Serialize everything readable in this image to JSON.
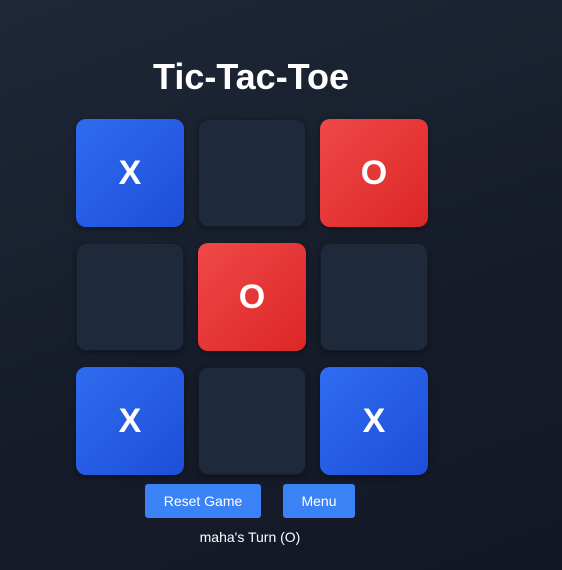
{
  "game": {
    "title": "Tic-Tac-Toe",
    "board": [
      "X",
      "",
      "O",
      "",
      "O",
      "",
      "X",
      "",
      "X"
    ],
    "status": "maha's Turn (O)"
  },
  "controls": {
    "reset_label": "Reset Game",
    "menu_label": "Menu"
  },
  "colors": {
    "background": "#1a2232",
    "x_tile": "#2563eb",
    "o_tile": "#ef4444",
    "empty_tile": "#1e293b",
    "button": "#3b82f6"
  }
}
